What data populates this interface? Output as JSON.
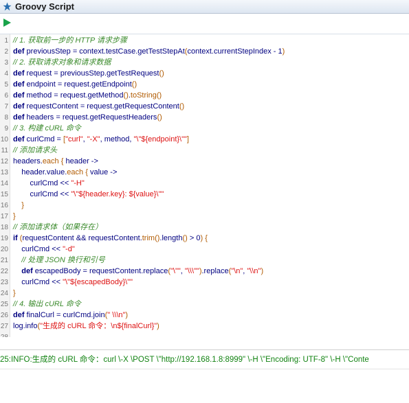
{
  "window": {
    "title": "Groovy Script"
  },
  "toolbar": {
    "run_tooltip": ""
  },
  "code_lines": [
    {
      "n": "1",
      "t": "// 1. 获取前一步的 HTTP 请求步骤"
    },
    {
      "n": "2",
      "t": "def previousStep = context.testCase.getTestStepAt(context.currentStepIndex - 1)"
    },
    {
      "n": "3",
      "t": "// 2. 获取请求对象和请求数据"
    },
    {
      "n": "4",
      "t": "def request = previousStep.getTestRequest()"
    },
    {
      "n": "5",
      "t": "def endpoint = request.getEndpoint()"
    },
    {
      "n": "6",
      "t": "def method = request.getMethod().toString()"
    },
    {
      "n": "7",
      "t": "def requestContent = request.getRequestContent()"
    },
    {
      "n": "8",
      "t": "def headers = request.getRequestHeaders()"
    },
    {
      "n": "9",
      "t": "// 3. 构建 cURL 命令"
    },
    {
      "n": "10",
      "t": "def curlCmd = [\"curl\", \"-X\", method, \"\\\"${endpoint}\\\"\"]"
    },
    {
      "n": "11",
      "t": "// 添加请求头"
    },
    {
      "n": "12",
      "t": "headers.each { header ->"
    },
    {
      "n": "13",
      "t": "    header.value.each { value ->"
    },
    {
      "n": "14",
      "t": "        curlCmd << \"-H\""
    },
    {
      "n": "15",
      "t": "        curlCmd << \"\\\"${header.key}: ${value}\\\"\""
    },
    {
      "n": "16",
      "t": "    }"
    },
    {
      "n": "17",
      "t": "}"
    },
    {
      "n": "18",
      "t": "// 添加请求体（如果存在）"
    },
    {
      "n": "19",
      "t": "if (requestContent && requestContent.trim().length() > 0) {"
    },
    {
      "n": "20",
      "t": "    curlCmd << \"-d\""
    },
    {
      "n": "21",
      "t": "    // 处理 JSON 换行和引号"
    },
    {
      "n": "22",
      "t": "    def escapedBody = requestContent.replace(\"\\\"\", \"\\\\\\\"\").replace(\"\\n\", \"\\\\n\")"
    },
    {
      "n": "23",
      "t": "    curlCmd << \"\\\"${escapedBody}\\\"\""
    },
    {
      "n": "24",
      "t": "}"
    },
    {
      "n": "25",
      "t": "// 4. 输出 cURL 命令"
    },
    {
      "n": "26",
      "t": "def finalCurl = curlCmd.join(\" \\\\\\n\")"
    },
    {
      "n": "27",
      "t": "log.info(\"生成的 cURL 命令：\\n${finalCurl}\")"
    },
    {
      "n": "28",
      "t": ""
    }
  ],
  "log": {
    "text": "25:INFO:生成的 cURL 命令：curl \\-X \\POST \\\"http://192.168.1.8:8999\" \\-H \\\"Encoding: UTF-8\" \\-H \\\"Conte"
  },
  "colors": {
    "keyword": "#000080",
    "comment": "#3a8a2b",
    "string": "#d11111",
    "method_call": "#b05a00",
    "log_text": "#128312"
  },
  "icons": {
    "title": "groovy-star-icon",
    "run": "run-play-icon"
  }
}
